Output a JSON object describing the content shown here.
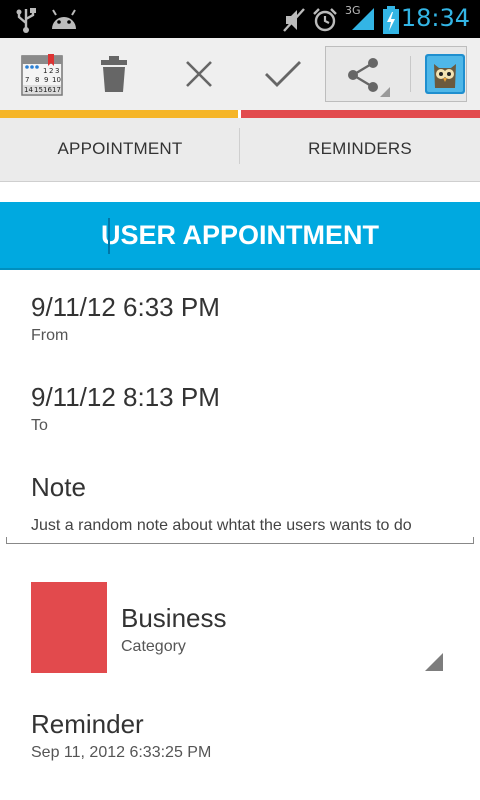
{
  "status_bar": {
    "time": "18:34",
    "network_label": "3G",
    "icons": [
      "usb-icon",
      "android-icon",
      "mute-icon",
      "alarm-icon",
      "signal-icon",
      "battery-icon"
    ]
  },
  "action_bar": {
    "buttons": [
      "calendar-icon",
      "delete-icon",
      "cancel-icon",
      "confirm-icon",
      "share-icon",
      "app-owl-icon"
    ],
    "calendar_icon_numbers": [
      "1",
      "2",
      "3",
      "7",
      "8",
      "9",
      "10",
      "14",
      "15",
      "16",
      "17"
    ]
  },
  "tabs": [
    {
      "label": "APPOINTMENT"
    },
    {
      "label": "REMINDERS"
    }
  ],
  "title": "USER APPOINTMENT",
  "from": {
    "value": "9/11/12 6:33 PM",
    "label": "From"
  },
  "to": {
    "value": "9/11/12 8:13 PM",
    "label": "To"
  },
  "note": {
    "heading": "Note",
    "text": "Just a random note about whtat the users wants to do"
  },
  "category": {
    "value": "Business",
    "label": "Category",
    "color": "#e24a4d"
  },
  "reminder": {
    "heading": "Reminder",
    "value": "Sep 11, 2012 6:33:25 PM"
  },
  "colors": {
    "accent_blue": "#00a9e0",
    "tab_yellow": "#f5b528",
    "tab_red": "#e24a4d"
  }
}
